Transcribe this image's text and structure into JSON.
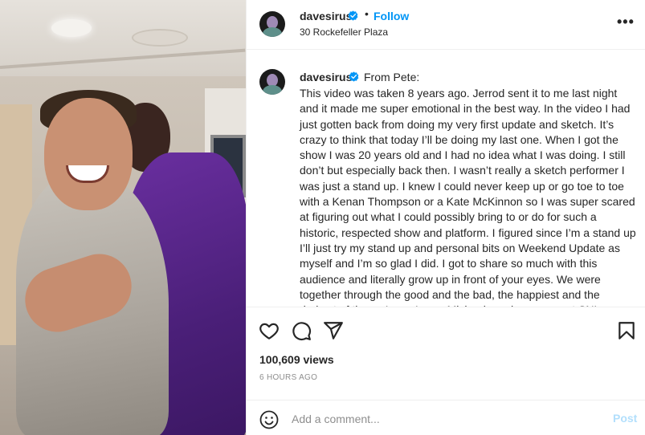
{
  "post": {
    "username": "davesirus",
    "follow_label": "Follow",
    "dot": "•",
    "location": "30 Rockefeller Plaza",
    "more_label": "•••"
  },
  "caption": {
    "username": "davesirus",
    "from": "From Pete:",
    "text": "This video was taken 8 years ago. Jerrod sent it to me last night and it made me super emotional in the best way. In the video I had just gotten back from doing my very first update and sketch. It’s crazy to think that today I’ll be doing my last one. When I got the show I was 20 years old and I had no idea what I was doing. I still don’t but especially back then. I wasn’t really a sketch performer I was just a stand up. I knew I could never keep up or go toe to toe with a Kenan Thompson or a Kate McKinnon so I was super scared at figuring out what I could possibly bring to or do for such a historic, respected show and platform. I figured since I’m a stand up I’ll just try my stand up and personal bits on Weekend Update as myself and I’m so glad I did. I got to share so much with this audience and literally grow up in front of your eyes. We were together through the good and the bad, the happiest and the darkest of times. I owe Lorne Michaels and everyone at SNL my life. Im so grateful and I"
  },
  "stats": {
    "views": "100,609 views",
    "time_ago": "6 HOURS AGO"
  },
  "comment_box": {
    "placeholder": "Add a comment...",
    "post_label": "Post"
  },
  "icons": {
    "like": "heart-icon",
    "comment": "comment-icon",
    "share": "share-icon",
    "save": "bookmark-icon",
    "emoji": "emoji-icon",
    "verified": "verified-badge-icon"
  },
  "colors": {
    "link_blue": "#0095f6",
    "post_disabled": "#b2dffc",
    "muted": "#8e8e8e",
    "text": "#262626"
  }
}
